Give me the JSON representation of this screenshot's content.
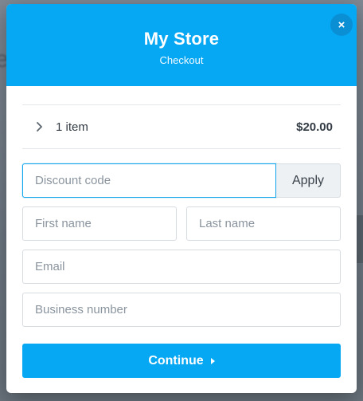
{
  "header": {
    "title": "My Store",
    "subtitle": "Checkout"
  },
  "close_icon": "×",
  "summary": {
    "item_count": "1 item",
    "total": "$20.00"
  },
  "discount": {
    "placeholder": "Discount code",
    "value": "",
    "apply_label": "Apply"
  },
  "form": {
    "first_name_placeholder": "First name",
    "last_name_placeholder": "Last name",
    "email_placeholder": "Email",
    "business_number_placeholder": "Business number"
  },
  "continue_label": "Continue",
  "colors": {
    "accent": "#06a7f3",
    "focus_border": "#0ea3ea"
  }
}
